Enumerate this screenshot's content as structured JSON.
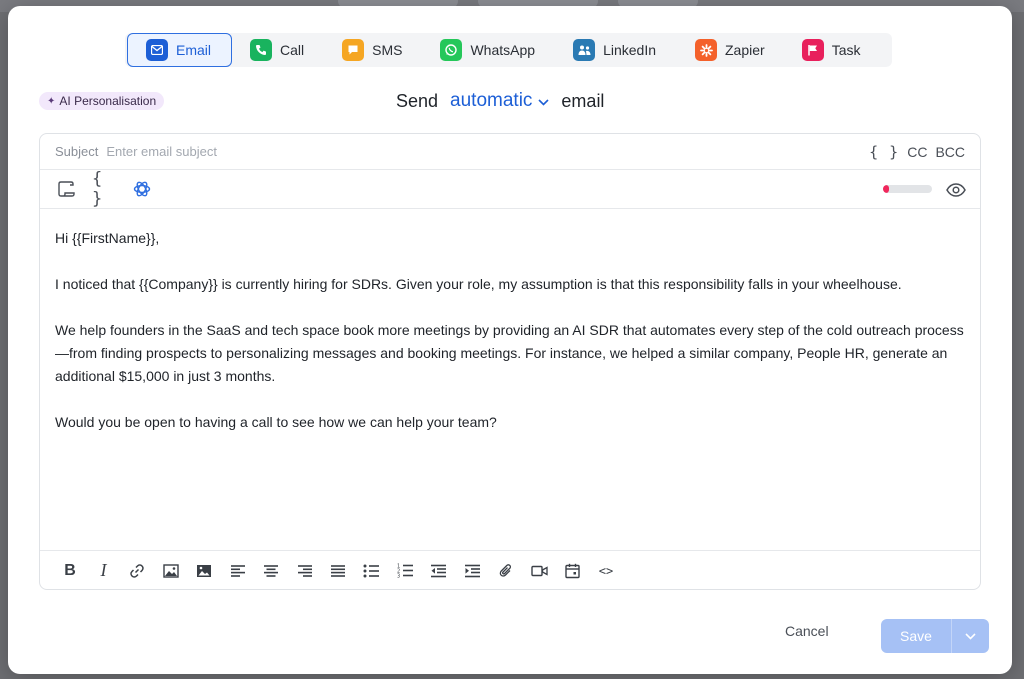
{
  "tabs": [
    {
      "label": "Email",
      "icon": "email-icon",
      "color": "#1d5fd6",
      "active": true
    },
    {
      "label": "Call",
      "icon": "phone-icon",
      "color": "#19b35e",
      "active": false
    },
    {
      "label": "SMS",
      "icon": "sms-icon",
      "color": "#f5a623",
      "active": false
    },
    {
      "label": "WhatsApp",
      "icon": "whatsapp-icon",
      "color": "#25c75a",
      "active": false
    },
    {
      "label": "LinkedIn",
      "icon": "linkedin-icon",
      "color": "#2a7ab3",
      "active": false
    },
    {
      "label": "Zapier",
      "icon": "zapier-icon",
      "color": "#f4612b",
      "active": false
    },
    {
      "label": "Task",
      "icon": "flag-icon",
      "color": "#e8205c",
      "active": false
    }
  ],
  "ai_badge": "AI Personalisation",
  "send_line": {
    "prefix": "Send",
    "mode": "automatic",
    "suffix": "email"
  },
  "subject": {
    "label": "Subject",
    "placeholder": "Enter email subject",
    "braces": "{ }",
    "cc": "CC",
    "bcc": "BCC"
  },
  "toolbar": {
    "braces": "{ }",
    "progress_fraction": 0.12,
    "progress_color": "#f0275c"
  },
  "body": {
    "greeting": "Hi {{FirstName}},",
    "p1": "I noticed that {{Company}} is currently hiring for SDRs. Given your role, my assumption is that this responsibility falls in your wheelhouse.",
    "p2": "We help founders in the SaaS and tech space book more meetings by providing an AI SDR that automates every step of the cold outreach process—from finding prospects to personalizing messages and booking meetings. For instance, we helped a similar company, People HR, generate an additional $15,000 in just 3 months.",
    "p3": "Would you be open to having a call to see how we can help your team?"
  },
  "format_bar": {
    "bold": "B",
    "italic": "I",
    "code": "<>"
  },
  "footer": {
    "cancel": "Cancel",
    "save": "Save"
  }
}
